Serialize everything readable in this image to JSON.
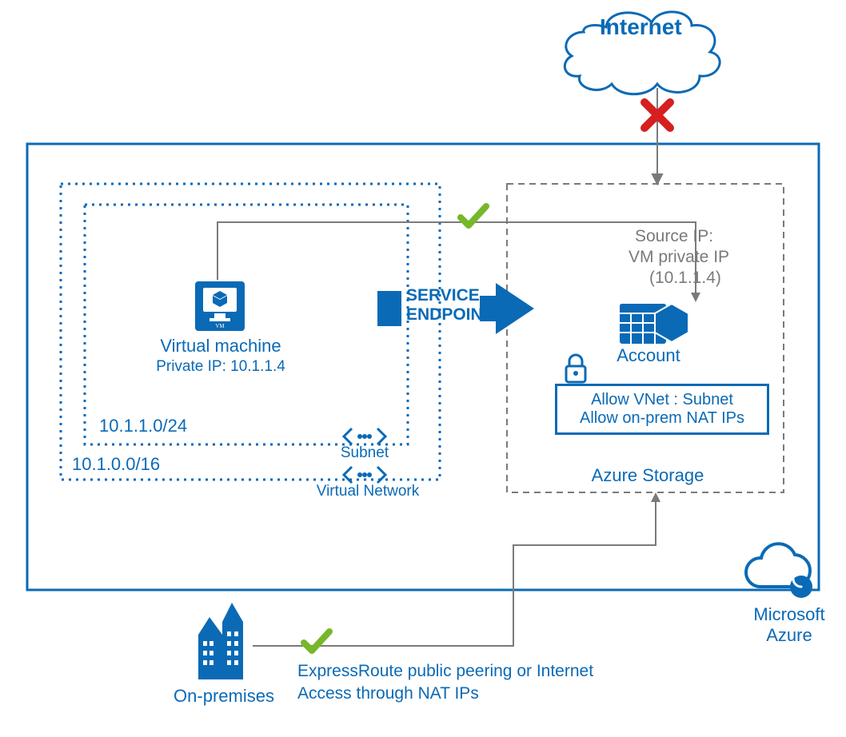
{
  "internet": {
    "label": "Internet"
  },
  "vm": {
    "title": "Virtual machine",
    "private_ip_label": "Private IP: 10.1.1.4"
  },
  "subnet": {
    "cidr": "10.1.1.0/24",
    "badge": "Subnet"
  },
  "vnet": {
    "cidr": "10.1.0.0/16",
    "badge": "Virtual Network"
  },
  "service_endpoint": {
    "label1": "SERVICE",
    "label2": "ENDPOINT"
  },
  "source_ip": {
    "line1": "Source IP:",
    "line2": "VM private IP",
    "line3": "(10.1.1.4)"
  },
  "storage": {
    "account_label": "Account",
    "section_title": "Azure Storage",
    "rule1": "Allow VNet : Subnet",
    "rule2": "Allow on-prem NAT IPs"
  },
  "onprem": {
    "label": "On-premises",
    "route_line1": "ExpressRoute public peering or Internet",
    "route_line2": "Access through NAT IPs"
  },
  "azure": {
    "line1": "Microsoft",
    "line2": "Azure"
  }
}
